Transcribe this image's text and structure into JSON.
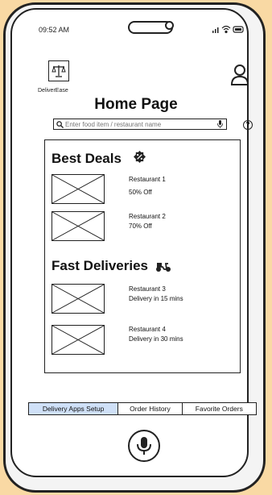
{
  "status_bar": {
    "time": "09:52 AM"
  },
  "app": {
    "logo_label": "DeliverEase"
  },
  "page": {
    "title": "Home Page"
  },
  "search": {
    "placeholder": "Enter food item / restaurant name"
  },
  "help": {
    "label": "?"
  },
  "sections": [
    {
      "title": "Best Deals",
      "items": [
        {
          "name": "Restaurant 1",
          "detail": "50% Off"
        },
        {
          "name": "Restaurant 2",
          "detail": "70% Off"
        }
      ]
    },
    {
      "title": "Fast Deliveries",
      "items": [
        {
          "name": "Restaurant 3",
          "detail": "Delivery in 15 mins"
        },
        {
          "name": "Restaurant 4",
          "detail": "Delivery in 30 mins"
        }
      ]
    }
  ],
  "tabs": [
    {
      "label": "Delivery Apps Setup",
      "active": true
    },
    {
      "label": "Order History",
      "active": false
    },
    {
      "label": "Favorite Orders",
      "active": false
    }
  ],
  "colors": {
    "background": "#f9d9a4",
    "active_tab": "#cfe0f7"
  },
  "icons": [
    "scale-logo-icon",
    "profile-icon",
    "search-icon",
    "mic-icon",
    "help-icon",
    "discount-badge-icon",
    "scooter-icon",
    "wifi-icon",
    "battery-icon",
    "signal-icon"
  ]
}
